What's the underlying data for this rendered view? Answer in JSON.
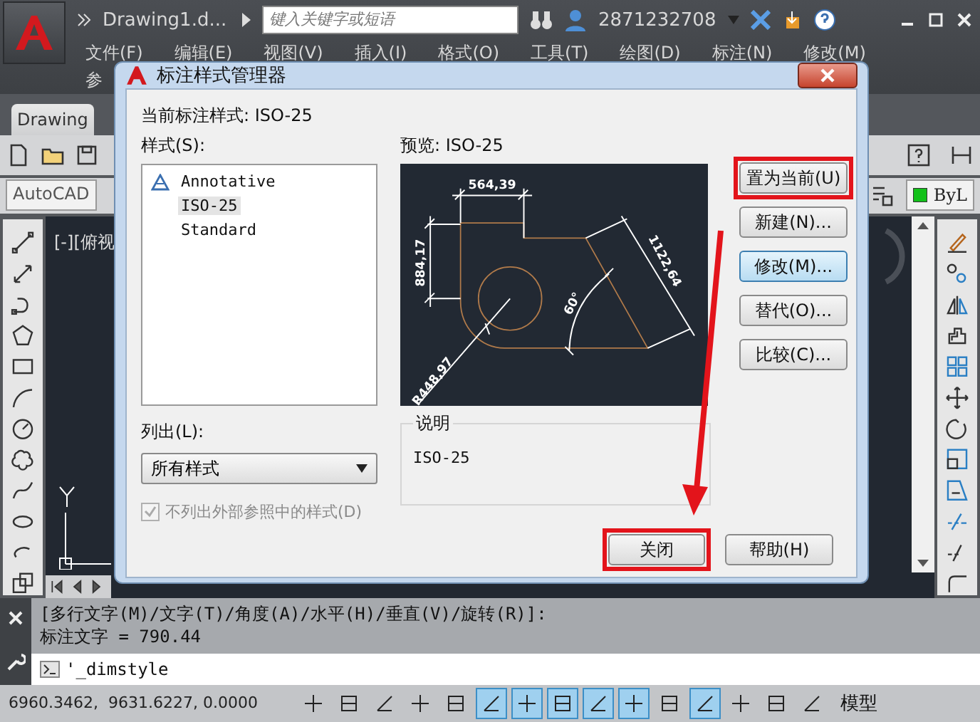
{
  "app": {
    "title": "Drawing1.d...",
    "search_placeholder": "键入关键字或短语",
    "user": "2871232708"
  },
  "menu": [
    {
      "label": "文件(F)"
    },
    {
      "label": "编辑(E)"
    },
    {
      "label": "视图(V)"
    },
    {
      "label": "插入(I)"
    },
    {
      "label": "格式(O)"
    },
    {
      "label": "工具(T)"
    },
    {
      "label": "绘图(D)"
    },
    {
      "label": "标注(N)"
    },
    {
      "label": "修改(M)"
    }
  ],
  "menu_second_row": [
    {
      "label": "参"
    }
  ],
  "file_tab": "Drawing",
  "workspace": "AutoCAD",
  "layer": "ByL",
  "viewport_label": "[-][俯视",
  "dialog": {
    "title": "标注样式管理器",
    "current": "当前标注样式: ISO-25",
    "styles_label": "样式(S):",
    "styles": [
      {
        "name": "Annotative",
        "annotative": true,
        "selected": false
      },
      {
        "name": "ISO-25",
        "annotative": false,
        "selected": true
      },
      {
        "name": "Standard",
        "annotative": false,
        "selected": false
      }
    ],
    "list_label": "列出(L):",
    "list_value": "所有样式",
    "xref_checkbox": {
      "label": "不列出外部参照中的样式(D)",
      "checked": true,
      "disabled": true
    },
    "preview_label": "预览: ISO-25",
    "preview_dimensions": [
      "564,39",
      "884,17",
      "1122,64",
      "60°",
      "R448,97"
    ],
    "description_label": "说明",
    "description": "ISO-25",
    "side_buttons": [
      {
        "label": "置为当前(U)",
        "focused": false,
        "highlighted": true
      },
      {
        "label": "新建(N)...",
        "focused": false,
        "highlighted": false
      },
      {
        "label": "修改(M)...",
        "focused": true,
        "highlighted": false
      },
      {
        "label": "替代(O)...",
        "focused": false,
        "highlighted": false
      },
      {
        "label": "比较(C)...",
        "focused": false,
        "highlighted": false
      }
    ],
    "bottom_buttons": [
      {
        "label": "关闭",
        "focused": false,
        "highlighted": true
      },
      {
        "label": "帮助(H)",
        "focused": false,
        "highlighted": false
      }
    ],
    "callout_arrow": true
  },
  "command": {
    "history": [
      "[多行文字(M)/文字(T)/角度(A)/水平(H)/垂直(V)/旋转(R)]:",
      "标注文字 = 790.44"
    ],
    "input": "'_dimstyle"
  },
  "status": {
    "coordinates": "6960.3462,  9631.6227, 0.0000",
    "model": "模型",
    "toggles": [
      {
        "on": false
      },
      {
        "on": false
      },
      {
        "on": false
      },
      {
        "on": false
      },
      {
        "on": false
      },
      {
        "on": true
      },
      {
        "on": true
      },
      {
        "on": true
      },
      {
        "on": true
      },
      {
        "on": true
      },
      {
        "on": false
      },
      {
        "on": true
      },
      {
        "on": false
      },
      {
        "on": false
      },
      {
        "on": false
      }
    ]
  }
}
